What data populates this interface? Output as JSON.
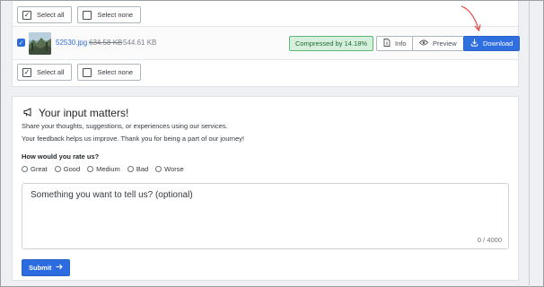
{
  "selection_top": {
    "select_all": "Select all",
    "select_none": "Select none"
  },
  "file": {
    "name": "52530.jpg",
    "original_size": "634.58 KB",
    "new_size": "544.61 KB",
    "badge": "Compressed by 14.18%",
    "info_label": "Info",
    "preview_label": "Preview",
    "download_label": "Download",
    "checked": true
  },
  "selection_bottom": {
    "select_all": "Select all",
    "select_none": "Select none"
  },
  "feedback": {
    "title": "Your input matters!",
    "line1": "Share your thoughts, suggestions, or experiences using our services.",
    "line2": "Your feedback helps us improve. Thank you for being a part of our journey!",
    "rate_question": "How would you rate us?",
    "options": [
      "Great",
      "Good",
      "Medium",
      "Bad",
      "Worse"
    ],
    "textarea_placeholder": "Something you want to tell us? (optional)",
    "char_count": "0 / 4000",
    "submit_label": "Submit"
  },
  "colors": {
    "primary": "#2f6fe0",
    "success_bg": "#d6f0dd",
    "success_text": "#1e6b33",
    "annotation_arrow": "#e53935"
  }
}
